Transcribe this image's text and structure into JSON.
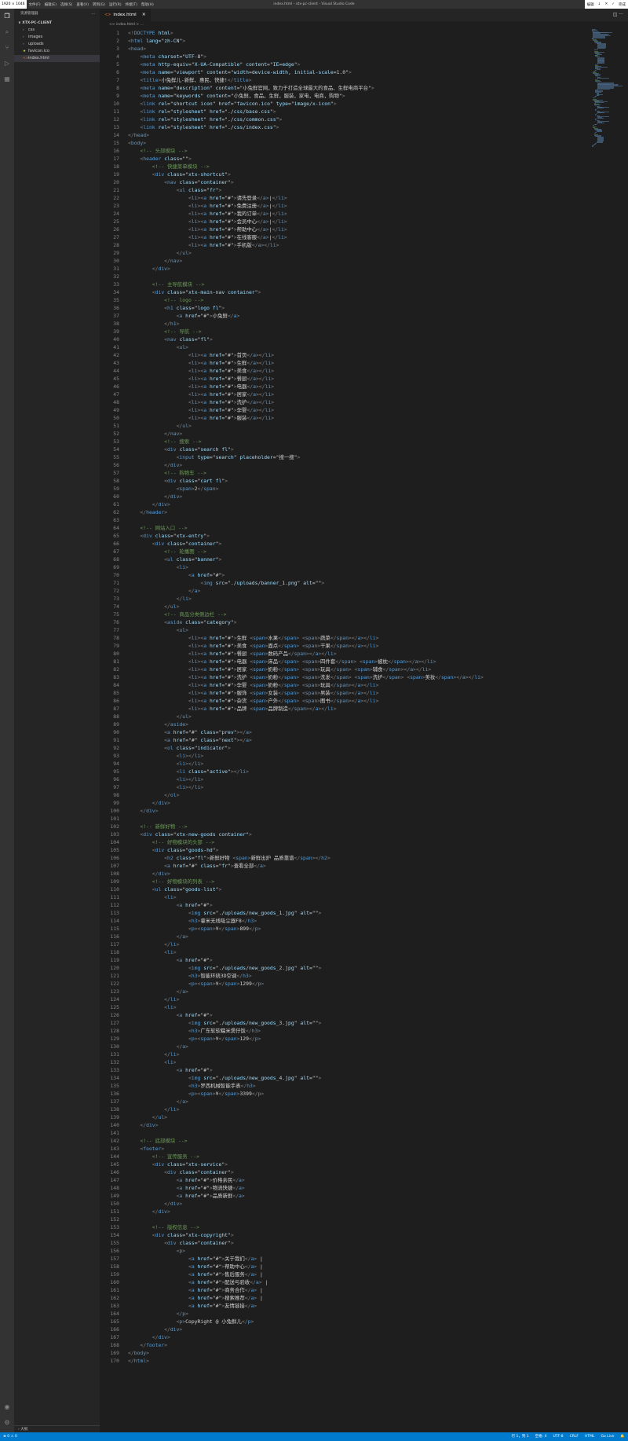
{
  "titlebar": {
    "badge": "1920 × 1046",
    "menus": [
      "文件(F)",
      "编辑(E)",
      "选择(S)",
      "查看(V)",
      "转到(G)",
      "运行(R)",
      "终端(T)",
      "帮助(H)"
    ],
    "window_title": "index.html - xtx-pc-client - Visual Studio Code",
    "right_actions": [
      "编辑",
      "↓",
      "✕",
      "✓",
      "完成"
    ]
  },
  "activity": {
    "icons": [
      "explorer-icon",
      "search-icon",
      "source-control-icon",
      "run-debug-icon",
      "extensions-icon"
    ],
    "bottom_icons": [
      "account-icon",
      "manage-gear-icon"
    ]
  },
  "sidebar": {
    "title": "资源管理器",
    "more": "···",
    "project": "∨ XTX-PC-CLIENT",
    "items": [
      {
        "label": "css",
        "icon": "›",
        "color": "#c5c5c5"
      },
      {
        "label": "images",
        "icon": "›",
        "color": "#c5c5c5"
      },
      {
        "label": "uploads",
        "icon": "›",
        "color": "#c5c5c5"
      },
      {
        "label": "favicon.ico",
        "icon": "★",
        "color": "#cbcb41"
      },
      {
        "label": "index.html",
        "icon": "<>",
        "color": "#e37933"
      }
    ],
    "outline": "› 大纲"
  },
  "editor": {
    "tab": {
      "label": "index.html",
      "close": "×"
    },
    "tab_actions": "◫ ···",
    "breadcrumb": "<> index.html > ...",
    "lines": [
      "<!DOCTYPE html>",
      "<html lang=\"zh-CN\">",
      "<head>",
      "    <meta charset=\"UTF-8\">",
      "    <meta http-equiv=\"X-UA-Compatible\" content=\"IE=edge\">",
      "    <meta name=\"viewport\" content=\"width=device-width, initial-scale=1.0\">",
      "    <title>小兔鲜儿-新鲜、惠民、快捷!</title>",
      "    <meta name=\"description\" content=\"小兔鲜官网，致力于打造全球最大的食品、生鲜电商平台\">",
      "    <meta name=\"keywords\" content=\"小兔鲜，食品，生鲜，服装，家电，电商，购物\">",
      "    <link rel=\"shortcut icon\" href=\"favicon.ico\" type=\"image/x-icon\">",
      "    <link rel=\"stylesheet\" href=\"./css/base.css\">",
      "    <link rel=\"stylesheet\" href=\"./css/common.css\">",
      "    <link rel=\"stylesheet\" href=\"./css/index.css\">",
      "</head>",
      "<body>",
      "    <!-- 头部模块 -->",
      "    <header class=\"\">",
      "        <!-- 快捷菜单模块 -->",
      "        <div class=\"xtx-shortcut\">",
      "            <nav class=\"container\">",
      "                <ul class=\"fr\">",
      "                    <li><a href=\"#\">请先登录</a>|</li>",
      "                    <li><a href=\"#\">免费注册</a>|</li>",
      "                    <li><a href=\"#\">我的订单</a>|</li>",
      "                    <li><a href=\"#\">会员中心</a>|</li>",
      "                    <li><a href=\"#\">帮助中心</a>|</li>",
      "                    <li><a href=\"#\">在线客服</a>|</li>",
      "                    <li><a href=\"#\">手机版</a></li>",
      "                </ul>",
      "            </nav>",
      "        </div>",
      "",
      "        <!-- 主导航模块 -->",
      "        <div class=\"xtx-main-nav container\">",
      "            <!-- logo -->",
      "            <h1 class=\"logo fl\">",
      "                <a href=\"#\">小兔鲜</a>",
      "            </h1>",
      "            <!-- 导航 -->",
      "            <nav class=\"fl\">",
      "                <ul>",
      "                    <li><a href=\"#\">首页</a></li>",
      "                    <li><a href=\"#\">生鲜</a></li>",
      "                    <li><a href=\"#\">美食</a></li>",
      "                    <li><a href=\"#\">餐厨</a></li>",
      "                    <li><a href=\"#\">电器</a></li>",
      "                    <li><a href=\"#\">居家</a></li>",
      "                    <li><a href=\"#\">洗护</a></li>",
      "                    <li><a href=\"#\">孕婴</a></li>",
      "                    <li><a href=\"#\">服装</a></li>",
      "                </ul>",
      "            </nav>",
      "            <!-- 搜索 -->",
      "            <div class=\"search fl\">",
      "                <input type=\"search\" placeholder=\"搜一搜\">",
      "            </div>",
      "            <!-- 购物车 -->",
      "            <div class=\"cart fl\">",
      "                <span>2</span>",
      "            </div>",
      "        </div>",
      "    </header>",
      "",
      "    <!-- 网站入口 -->",
      "    <div class=\"xtx-entry\">",
      "        <div class=\"container\">",
      "            <!-- 轮播图 -->",
      "            <ul class=\"banner\">",
      "                <li>",
      "                    <a href=\"#\">",
      "                        <img src=\"./uploads/banner_1.png\" alt=\"\">",
      "                    </a>",
      "                </li>",
      "            </ul>",
      "            <!-- 商品分类侧边栏 -->",
      "            <aside class=\"category\">",
      "                <ul>",
      "                    <li><a href=\"#\">生鲜 <span>水果</span> <span>蔬菜</span></a></li>",
      "                    <li><a href=\"#\">美食 <span>面点</span> <span>干果</span></a></li>",
      "                    <li><a href=\"#\">餐厨 <span>数码产品</span></a></li>",
      "                    <li><a href=\"#\">电器 <span>床品</span> <span>四件套</span> <span>被枕</span></a></li>",
      "                    <li><a href=\"#\">居家 <span>奶粉</span> <span>玩具</span> <span>辅食</span></a></li>",
      "                    <li><a href=\"#\">洗护 <span>奶粉</span> <span>洗发</span> <span>洗护</span> <span>美妆</span></a></li>",
      "                    <li><a href=\"#\">孕婴 <span>奶粉</span> <span>玩具</span></a></li>",
      "                    <li><a href=\"#\">服饰 <span>女装</span> <span>男装</span></a></li>",
      "                    <li><a href=\"#\">杂货 <span>户外</span> <span>图书</span></a></li>",
      "                    <li><a href=\"#\">品牌 <span>品牌制造</span></a></li>",
      "                </ul>",
      "            </aside>",
      "            <a href=\"#\" class=\"prev\"></a>",
      "            <a href=\"#\" class=\"next\"></a>",
      "            <ol class=\"indicator\">",
      "                <li></li>",
      "                <li></li>",
      "                <li class=\"active\"></li>",
      "                <li></li>",
      "                <li></li>",
      "            </ol>",
      "        </div>",
      "    </div>",
      "",
      "    <!-- 新鲜好物 -->",
      "    <div class=\"xtx-new-goods container\">",
      "        <!-- 好物模块的头部 -->",
      "        <div class=\"goods-hd\">",
      "            <h2 class=\"fl\">新鲜好物 <span>新鲜出炉 品质靠谱</span></h2>",
      "            <a href=\"#\" class=\"fr\">查看全部</a>",
      "        </div>",
      "        <!-- 好物模块的列表 -->",
      "        <ul class=\"goods-list\">",
      "            <li>",
      "                <a href=\"#\">",
      "                    <img src=\"./uploads/new_goods_1.jpg\" alt=\"\">",
      "                    <h3>睿米无线吸尘器F8</h3>",
      "                    <p><span>¥</span>899</p>",
      "                </a>",
      "            </li>",
      "            <li>",
      "                <a href=\"#\">",
      "                    <img src=\"./uploads/new_goods_2.jpg\" alt=\"\">",
      "                    <h3>智能环绕3D空调</h3>",
      "                    <p><span>¥</span>1299</p>",
      "                </a>",
      "            </li>",
      "            <li>",
      "                <a href=\"#\">",
      "                    <img src=\"./uploads/new_goods_3.jpg\" alt=\"\">",
      "                    <h3>广东软软糯米煲仔饭</h3>",
      "                    <p><span>¥</span>129</p>",
      "                </a>",
      "            </li>",
      "            <li>",
      "                <a href=\"#\">",
      "                    <img src=\"./uploads/new_goods_4.jpg\" alt=\"\">",
      "                    <h3>罗西机械智能手表</h3>",
      "                    <p><span>¥</span>3399</p>",
      "                </a>",
      "            </li>",
      "        </ul>",
      "    </div>",
      "",
      "    <!-- 底部模块 -->",
      "    <footer>",
      "        <!-- 宣传服务 -->",
      "        <div class=\"xtx-service\">",
      "            <div class=\"container\">",
      "                <a href=\"#\">价格亲民</a>",
      "                <a href=\"#\">物流快捷</a>",
      "                <a href=\"#\">品质新鲜</a>",
      "            </div>",
      "        </div>",
      "",
      "        <!-- 版权信息 -->",
      "        <div class=\"xtx-copyright\">",
      "            <div class=\"container\">",
      "                <p>",
      "                    <a href=\"#\">关于我们</a> |",
      "                    <a href=\"#\">帮助中心</a> |",
      "                    <a href=\"#\">售后服务</a> |",
      "                    <a href=\"#\">配送与验收</a> |",
      "                    <a href=\"#\">商务合作</a> |",
      "                    <a href=\"#\">搜索推荐</a> |",
      "                    <a href=\"#\">友情链接</a>",
      "                </p>",
      "                <p>CopyRight @ 小兔鲜儿</p>",
      "            </div>",
      "        </div>",
      "    </footer>",
      "</body>",
      "</html>"
    ]
  },
  "statusbar": {
    "left": "⊗ 0  ⚠ 0",
    "right": [
      "行 1，列 1",
      "空格: 4",
      "UTF-8",
      "CRLF",
      "HTML",
      "Go Live",
      "🔔"
    ]
  },
  "colors": {
    "tag": "#569cd6",
    "attr": "#9cdcfe",
    "value": "#ce9178",
    "comment": "#6a9955",
    "text": "#d4d4d4",
    "status": "#007acc"
  }
}
